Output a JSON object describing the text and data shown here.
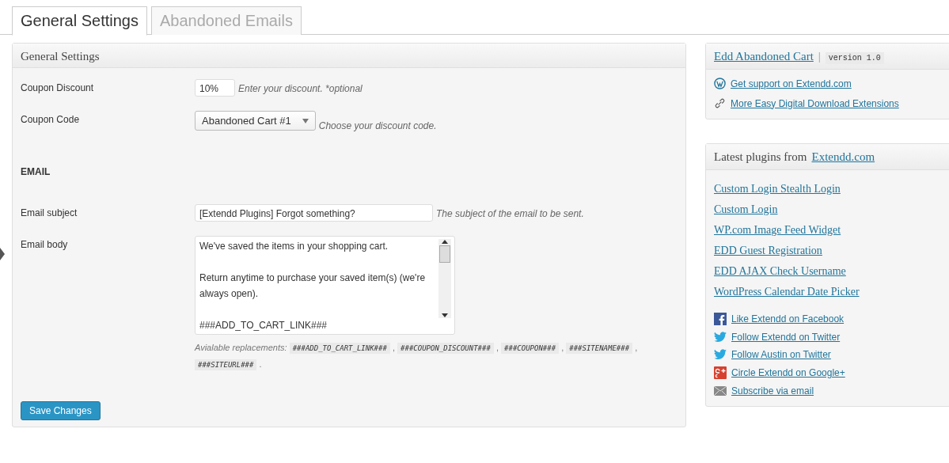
{
  "tabs": [
    {
      "label": "General Settings",
      "selected": true
    },
    {
      "label": "Abandoned Emails",
      "selected": false
    }
  ],
  "settings_panel": {
    "title": "General Settings",
    "coupon_discount": {
      "label": "Coupon Discount",
      "value": "10%",
      "hint": "Enter your discount. *optional"
    },
    "coupon_code": {
      "label": "Coupon Code",
      "value": "Abandoned Cart #1",
      "hint": "Choose your discount code."
    },
    "email_heading": "EMAIL",
    "email_subject": {
      "label": "Email subject",
      "value": "[Extendd Plugins] Forgot something?",
      "hint": "The subject of the email to be sent."
    },
    "email_body": {
      "label": "Email body",
      "paragraphs": [
        "We've saved the items in your shopping cart.",
        "Return anytime to purchase your saved item(s) (we're always open).",
        "###ADD_TO_CART_LINK###"
      ]
    },
    "replacements": {
      "label": "Avialable replacements:",
      "codes": [
        "###ADD_TO_CART_LINK###",
        "###COUPON_DISCOUNT###",
        "###COUPON###",
        "###SITENAME###",
        "###SITEURL###"
      ],
      "separator": ",",
      "end": "."
    },
    "save_button": "Save Changes"
  },
  "plugin_box": {
    "title": "Edd Abandoned Cart",
    "divider": "|",
    "version": "version 1.0",
    "links": [
      {
        "kind": "wordpress",
        "label": "Get support on Extendd.com"
      },
      {
        "kind": "link",
        "label": "More Easy Digital Download Extensions"
      }
    ]
  },
  "latest_box": {
    "title": "Latest plugins from",
    "title_link": "Extendd.com",
    "plugins": [
      "Custom Login Stealth Login",
      "Custom Login",
      "WP.com Image Feed Widget",
      "EDD Guest Registration",
      "EDD AJAX Check Username",
      "WordPress Calendar Date Picker"
    ],
    "social": [
      {
        "kind": "facebook",
        "label": "Like Extendd on Facebook"
      },
      {
        "kind": "twitter",
        "label": "Follow Extendd on Twitter"
      },
      {
        "kind": "twitter",
        "label": "Follow Austin on Twitter"
      },
      {
        "kind": "google",
        "label": "Circle Extendd on Google+"
      },
      {
        "kind": "email",
        "label": "Subscribe via email"
      }
    ]
  }
}
